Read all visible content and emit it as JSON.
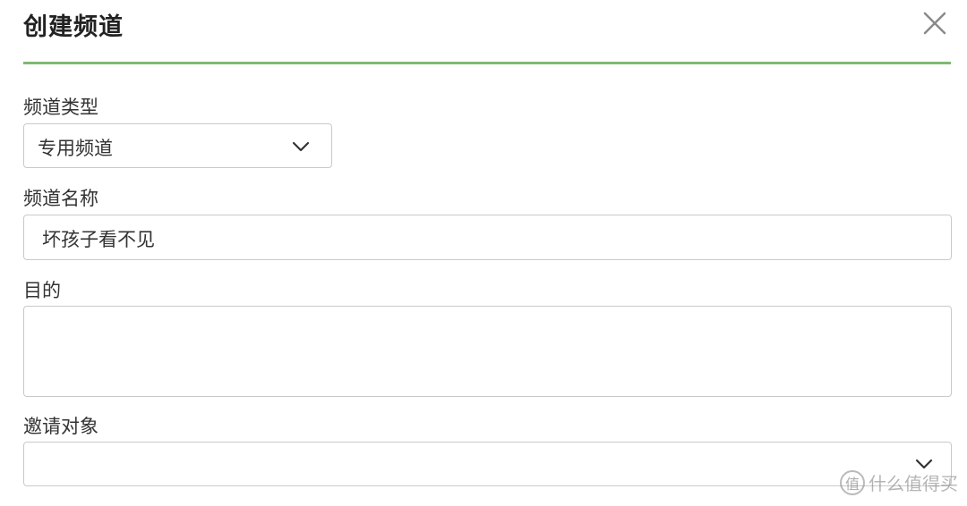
{
  "dialog": {
    "title": "创建频道"
  },
  "fields": {
    "channel_type": {
      "label": "频道类型",
      "value": "专用频道"
    },
    "channel_name": {
      "label": "频道名称",
      "value": "坏孩子看不见"
    },
    "purpose": {
      "label": "目的",
      "value": ""
    },
    "invite": {
      "label": "邀请对象",
      "value": ""
    }
  },
  "watermark": {
    "logo_char": "值",
    "text": "什么值得买"
  },
  "colors": {
    "accent": "#7dba72",
    "border": "#c9c9c9",
    "text": "#333333",
    "icon": "#888888"
  },
  "icons": {
    "close": "close-icon",
    "dropdown": "chevron-down-icon"
  }
}
